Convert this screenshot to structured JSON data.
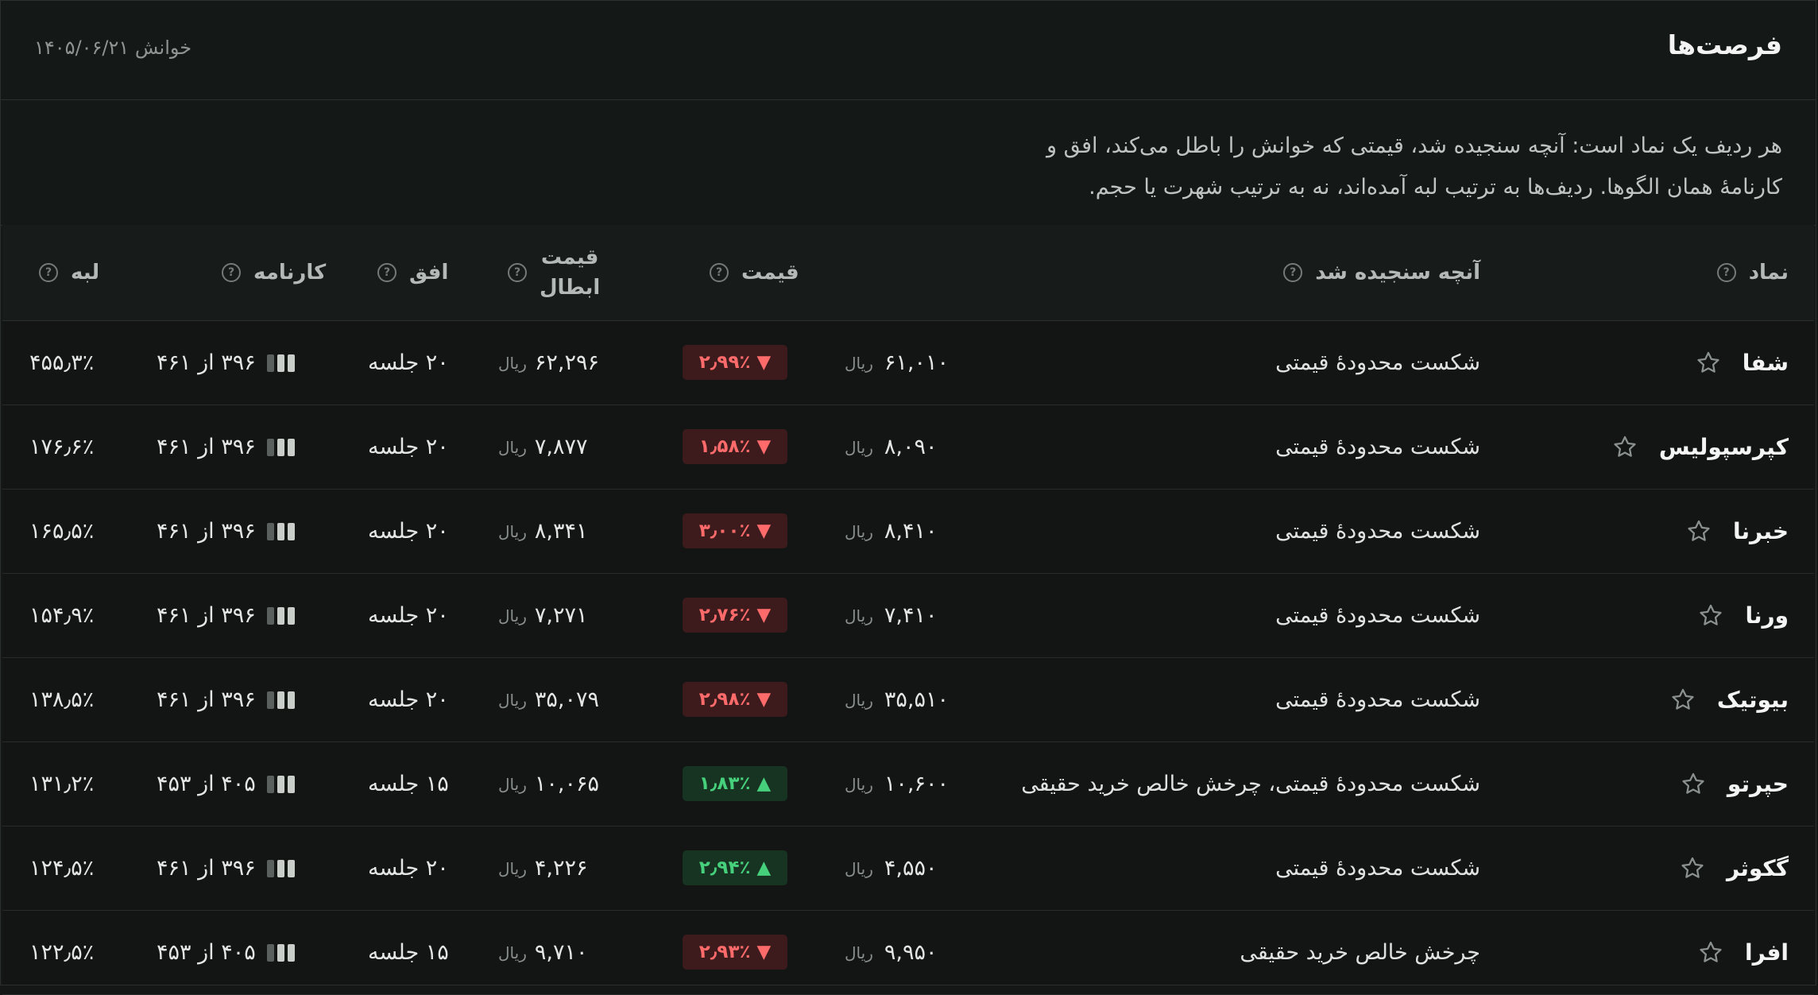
{
  "header": {
    "title": "فرصت‌ها",
    "reading": "خوانش ۱۴۰۵/۰۶/۲۱"
  },
  "description": "هر ردیف یک نماد است: آنچه سنجیده شد، قیمتی که خوانش را باطل می‌کند، افق و کارنامهٔ همان الگوها. ردیف‌ها به ترتیب لبه آمده‌اند، نه به ترتیب شهرت یا حجم.",
  "columns": {
    "symbol": "نماد",
    "measured": "آنچه سنجیده شد",
    "price": "قیمت",
    "invalidation_line1": "قیمت",
    "invalidation_line2": "ابطال",
    "horizon": "افق",
    "record": "کارنامه",
    "edge": "لبه"
  },
  "currency": "ریال",
  "colors": {
    "down": "#ff6b6b",
    "up": "#46d07c"
  },
  "rows": [
    {
      "symbol": "شفا",
      "measured": "شکست محدودهٔ قیمتی",
      "price": "۶۱,۰۱۰",
      "change": "۲٫۹۹٪",
      "direction": "down",
      "arrow": "▼",
      "invalidation": "۶۲,۲۹۶",
      "horizon": "۲۰ جلسه",
      "record": "۳۹۶ از ۴۶۱",
      "edge": "۴۵۵٫۳٪"
    },
    {
      "symbol": "کپرسپولیس",
      "measured": "شکست محدودهٔ قیمتی",
      "price": "۸,۰۹۰",
      "change": "۱٫۵۸٪",
      "direction": "down",
      "arrow": "▼",
      "invalidation": "۷,۸۷۷",
      "horizon": "۲۰ جلسه",
      "record": "۳۹۶ از ۴۶۱",
      "edge": "۱۷۶٫۶٪"
    },
    {
      "symbol": "خبرنا",
      "measured": "شکست محدودهٔ قیمتی",
      "price": "۸,۴۱۰",
      "change": "۳٫۰۰٪",
      "direction": "down",
      "arrow": "▼",
      "invalidation": "۸,۳۴۱",
      "horizon": "۲۰ جلسه",
      "record": "۳۹۶ از ۴۶۱",
      "edge": "۱۶۵٫۵٪"
    },
    {
      "symbol": "ورنا",
      "measured": "شکست محدودهٔ قیمتی",
      "price": "۷,۴۱۰",
      "change": "۲٫۷۶٪",
      "direction": "down",
      "arrow": "▼",
      "invalidation": "۷,۲۷۱",
      "horizon": "۲۰ جلسه",
      "record": "۳۹۶ از ۴۶۱",
      "edge": "۱۵۴٫۹٪"
    },
    {
      "symbol": "بیوتیک",
      "measured": "شکست محدودهٔ قیمتی",
      "price": "۳۵,۵۱۰",
      "change": "۲٫۹۸٪",
      "direction": "down",
      "arrow": "▼",
      "invalidation": "۳۵,۰۷۹",
      "horizon": "۲۰ جلسه",
      "record": "۳۹۶ از ۴۶۱",
      "edge": "۱۳۸٫۵٪"
    },
    {
      "symbol": "حپرتو",
      "measured": "شکست محدودهٔ قیمتی، چرخش خالص خرید حقیقی",
      "price": "۱۰,۶۰۰",
      "change": "۱٫۸۳٪",
      "direction": "up",
      "arrow": "▲",
      "invalidation": "۱۰,۰۶۵",
      "horizon": "۱۵ جلسه",
      "record": "۴۰۵ از ۴۵۳",
      "edge": "۱۳۱٫۲٪"
    },
    {
      "symbol": "گکوثر",
      "measured": "شکست محدودهٔ قیمتی",
      "price": "۴,۵۵۰",
      "change": "۲٫۹۴٪",
      "direction": "up",
      "arrow": "▲",
      "invalidation": "۴,۲۲۶",
      "horizon": "۲۰ جلسه",
      "record": "۳۹۶ از ۴۶۱",
      "edge": "۱۲۴٫۵٪"
    },
    {
      "symbol": "افرا",
      "measured": "چرخش خالص خرید حقیقی",
      "price": "۹,۹۵۰",
      "change": "۲٫۹۳٪",
      "direction": "down",
      "arrow": "▼",
      "invalidation": "۹,۷۱۰",
      "horizon": "۱۵ جلسه",
      "record": "۴۰۵ از ۴۵۳",
      "edge": "۱۲۲٫۵٪"
    }
  ]
}
